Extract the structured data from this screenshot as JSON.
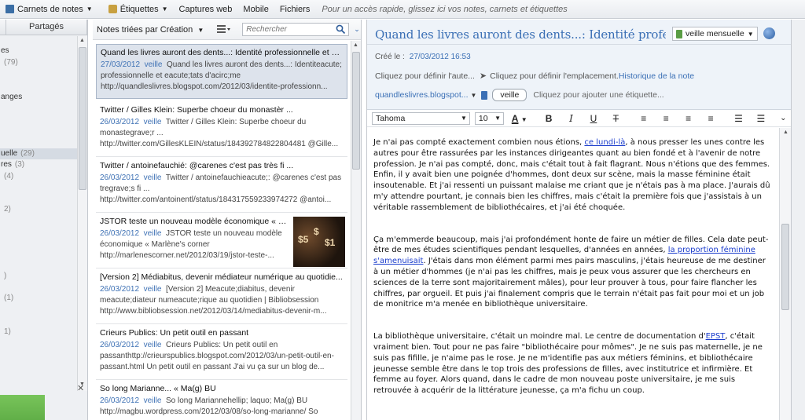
{
  "toolbar": {
    "notebooks": "Carnets de notes",
    "tags": "Étiquettes",
    "web_clips": "Captures web",
    "mobile": "Mobile",
    "files": "Fichiers",
    "hint": "Pour un accès rapide, glissez ici vos notes, carnets et étiquettes"
  },
  "left": {
    "tab_shared": "Partagés",
    "rows": [
      {
        "label": "es",
        "count": ""
      },
      {
        "label": "",
        "count": "(79)"
      },
      {
        "label": "",
        "count": ""
      },
      {
        "label": "",
        "count": ""
      },
      {
        "label": "anges",
        "count": ""
      },
      {
        "label": "",
        "count": ""
      },
      {
        "label": "",
        "count": ""
      },
      {
        "label": "",
        "count": ""
      },
      {
        "label": "",
        "count": ""
      },
      {
        "label": "uelle",
        "count": "(29)"
      },
      {
        "label": "res",
        "count": "(3)"
      },
      {
        "label": "",
        "count": "(4)"
      },
      {
        "label": "",
        "count": ""
      },
      {
        "label": "",
        "count": ""
      },
      {
        "label": "",
        "count": "2)"
      },
      {
        "label": "",
        "count": ""
      },
      {
        "label": "",
        "count": ""
      },
      {
        "label": "",
        "count": ""
      },
      {
        "label": "",
        "count": ""
      },
      {
        "label": "",
        "count": ""
      },
      {
        "label": "",
        "count": ")"
      },
      {
        "label": "",
        "count": ""
      },
      {
        "label": "",
        "count": "(1)"
      },
      {
        "label": "",
        "count": ""
      },
      {
        "label": "",
        "count": ""
      },
      {
        "label": "",
        "count": "1)"
      }
    ]
  },
  "list": {
    "sort_label": "Notes triées par Création",
    "search_placeholder": "Rechercher",
    "notes": [
      {
        "title": "Quand les livres auront des dents...: Identité professionnelle et état...",
        "date": "27/03/2012",
        "notebook": "veille",
        "text": "Quand les livres auront des dents...: Identiteacute; professionnelle et eacute;tats d'acirc;me http://quandleslivres.blogspot.com/2012/03/identite-professionn..."
      },
      {
        "title": "Twitter / Gilles Klein: Superbe choeur du monastèr ...",
        "date": "26/03/2012",
        "notebook": "veille",
        "text": "Twitter / Gilles Klein: Superbe choeur du monastegrave;r ... http://twitter.com/GillesKLEIN/status/184392784822804481 @Gille..."
      },
      {
        "title": "Twitter / antoinefauchié: @carenes c'est pas très fi ...",
        "date": "26/03/2012",
        "notebook": "veille",
        "text": "Twitter / antoinefauchieacute;: @carenes c'est pas tregrave;s fi ... http://twitter.com/antoinentl/status/184317559233974272 @antoi..."
      },
      {
        "title": "JSTOR teste un nouveau modèle économique « M...",
        "date": "26/03/2012",
        "notebook": "veille",
        "text": "JSTOR teste un nouveau modèle économique « Marlène's corner http://marlenescorner.net/2012/03/19/jstor-teste-..."
      },
      {
        "title": "[Version 2] Médiabitus, devenir médiateur numérique au quotidie...",
        "date": "26/03/2012",
        "notebook": "veille",
        "text": "[Version 2] Meacute;diabitus, devenir meacute;diateur numeacute;rique au quotidien | Bibliobsession http://www.bibliobsession.net/2012/03/14/mediabitus-devenir-m..."
      },
      {
        "title": "Crieurs Publics: Un petit outil en passant",
        "date": "26/03/2012",
        "notebook": "veille",
        "text": "Crieurs Publics: Un petit outil en passanthttp://crieurspublics.blogspot.com/2012/03/un-petit-outil-en-passant.html Un petit outil en passant J'ai vu ça sur un blog de..."
      },
      {
        "title": "So long Marianne... « Ma(g) BU",
        "date": "26/03/2012",
        "notebook": "veille",
        "text": "So long Mariannehellip; laquo; Ma(g) BU http://magbu.wordpress.com/2012/03/08/so-long-marianne/ So"
      }
    ]
  },
  "editor": {
    "title": "Quand les livres auront des dents...: Identité professionnelle et",
    "notebook": "veille mensuelle",
    "created_label": "Créé le :",
    "created_value": "27/03/2012 16:53",
    "author_prompt": "Cliquez pour définir l'aute...",
    "location_prompt": "Cliquez pour définir l'emplacement.",
    "history_link": "Historique de la note",
    "source_link": "quandleslivres.blogspot...",
    "tag": "veille",
    "add_tag_prompt": "Cliquez pour ajouter une étiquette...",
    "font": "Tahoma",
    "font_size": "10",
    "p1_a": "Je n'ai pas compté exactement combien nous étions, ",
    "p1_link": "ce lundi-là",
    "p1_b": ", à nous presser les unes contre les autres pour être rassurées par les instances dirigeantes quant au bien fondé et à l'avenir de notre profession. Je n'ai pas compté, donc, mais c'était tout à fait flagrant. Nous n'étions que des femmes. Enfin, il y avait bien une poignée d'hommes, dont deux sur scène, mais la masse féminine était insoutenable. Et j'ai ressenti un puissant malaise me criant que je n'étais pas à ma place. J'aurais dû m'y attendre pourtant, je connais bien les chiffres, mais c'était la première fois que j'assistais à un véritable rassemblement de bibliothécaires, et j'ai été choquée.",
    "p2_a": "Ça m'emmerde beaucoup, mais j'ai profondément honte de faire un métier de filles. Cela date peut-être de mes études scientifiques pendant lesquelles, d'années en années, ",
    "p2_link": "la proportion féminine s'amenuisait",
    "p2_b": ". J'étais dans mon élément parmi mes pairs masculins, j'étais heureuse de me destiner à un métier d'hommes (je n'ai pas les chiffres, mais je peux vous assurer que les chercheurs en sciences de la terre sont majoritairement mâles), pour leur prouver à tous, pour faire flancher les chiffres, par orgueil. Et puis j'ai finalement compris que le terrain n'était pas fait pour moi et un job de monitrice m'a menée en bibliothèque universitaire.",
    "p3_a": "La bibliothèque universitaire, c'était un moindre mal. Le centre de documentation d'",
    "p3_link": "EPST",
    "p3_b": ", c'était vraiment bien. Tout pour ne pas faire \"bibliothécaire pour mômes\". Je ne suis pas maternelle, je ne suis pas fifille, je n'aime pas le rose. Je ne m'identifie pas aux métiers féminins, et bibliothécaire jeunesse semble être dans le top trois des professions de filles, avec institutrice et infirmière. Et femme au foyer. Alors quand, dans le cadre de mon nouveau poste universitaire, je me suis retrouvée à acquérir de la littérature jeunesse, ça m'a fichu un coup."
  }
}
